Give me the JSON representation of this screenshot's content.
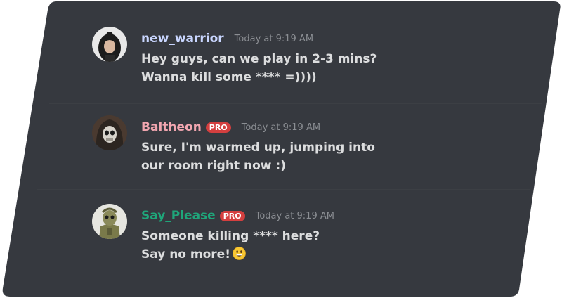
{
  "colors": {
    "panel": "#36393f",
    "divider": "#42454a",
    "badge": "#d43f3f",
    "timestamp": "#8b8e93",
    "message_text": "#dcddde"
  },
  "messages": [
    {
      "username": "new_warrior",
      "username_color": "#c9d6ff",
      "badge": "",
      "timestamp": "Today at 9:19 AM",
      "lines": [
        "Hey guys, can we play in 2-3 mins?",
        "Wanna kill some **** =))))"
      ],
      "avatar_icon": "long-hair-avatar-icon"
    },
    {
      "username": "Baltheon",
      "username_color": "#f2a6b0",
      "badge": "PRO",
      "timestamp": "Today at 9:19 AM",
      "lines": [
        "Sure, I'm warmed up, jumping into",
        "our room right now :)"
      ],
      "avatar_icon": "skull-hood-avatar-icon"
    },
    {
      "username": "Say_Please",
      "username_color": "#1fa67a",
      "badge": "PRO",
      "timestamp": "Today at 9:19 AM",
      "lines": [
        "Someone killing **** here?",
        "Say no more!"
      ],
      "trailing_emoji": "grinning-face-emoji",
      "avatar_icon": "soldier-avatar-icon"
    }
  ]
}
